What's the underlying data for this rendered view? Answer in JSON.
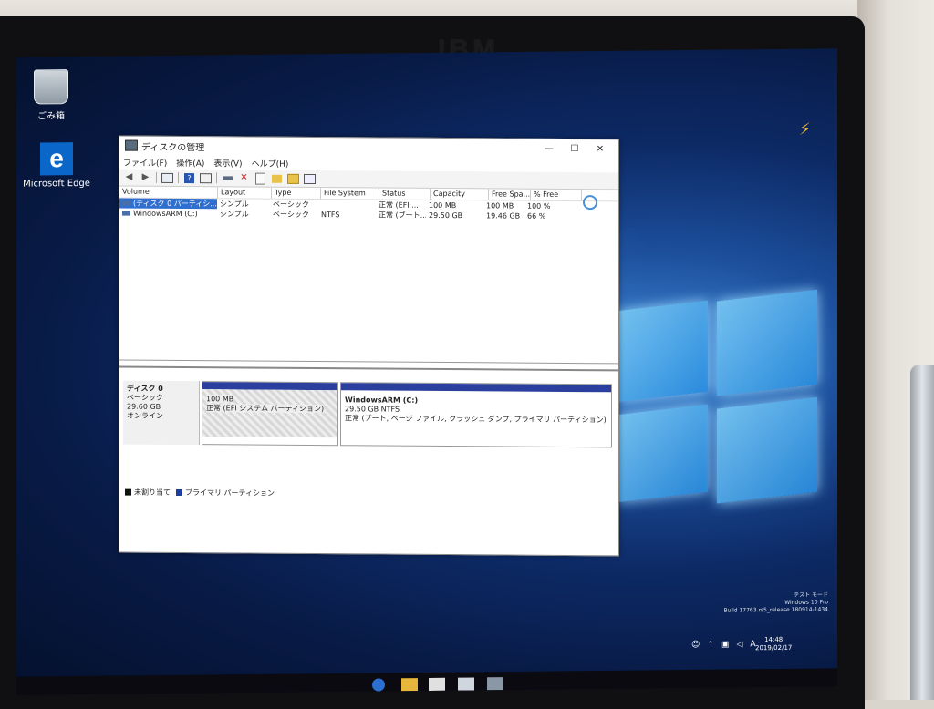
{
  "monitor": {
    "brand": "IBM"
  },
  "desktop": {
    "icons": [
      {
        "label": "ごみ箱",
        "name": "recycle-bin-icon"
      },
      {
        "label": "Microsoft Edge",
        "name": "edge-icon"
      }
    ]
  },
  "window": {
    "title": "ディスクの管理",
    "controls": {
      "minimize": "—",
      "maximize": "☐",
      "close": "✕"
    },
    "menu": [
      "ファイル(F)",
      "操作(A)",
      "表示(V)",
      "ヘルプ(H)"
    ],
    "toolbar": [
      "back-icon",
      "forward-icon",
      "console-tree-icon",
      "help-icon",
      "properties-icon",
      "disk-icon",
      "delete-icon",
      "check-icon",
      "open-folder-icon",
      "explore-icon",
      "rescan-icon"
    ],
    "columns": [
      "Volume",
      "Layout",
      "Type",
      "File System",
      "Status",
      "Capacity",
      "Free Spa...",
      "% Free"
    ],
    "rows": [
      {
        "volume": "(ディスク 0 パーティシ...",
        "layout": "シンプル",
        "type": "ベーシック",
        "fs": "",
        "status": "正常 (EFI ...",
        "capacity": "100 MB",
        "free": "100 MB",
        "pct": "100 %",
        "selected": true
      },
      {
        "volume": "WindowsARM (C:)",
        "layout": "シンプル",
        "type": "ベーシック",
        "fs": "NTFS",
        "status": "正常 (ブート...",
        "capacity": "29.50 GB",
        "free": "19.46 GB",
        "pct": "66 %",
        "selected": false
      }
    ],
    "disk": {
      "name": "ディスク 0",
      "kind": "ベーシック",
      "size": "29.60 GB",
      "state": "オンライン",
      "partitions": [
        {
          "size": "100 MB",
          "status": "正常 (EFI システム パーティション)"
        },
        {
          "label": "WindowsARM (C:)",
          "size": "29.50 GB NTFS",
          "status": "正常 (ブート, ページ ファイル, クラッシュ ダンプ, プライマリ パーティション)"
        }
      ]
    },
    "legend": [
      {
        "label": "未割り当て",
        "color": "#111111"
      },
      {
        "label": "プライマリ パーティション",
        "color": "#1f3fa0"
      }
    ]
  },
  "watermark": {
    "line1": "テスト モード",
    "line2": "Windows 10 Pro",
    "line3": "Build 17763.rs5_release.180914-1434"
  },
  "clock": {
    "time": "14:48",
    "date": "2019/02/17"
  },
  "tray": {
    "ime": "A"
  }
}
